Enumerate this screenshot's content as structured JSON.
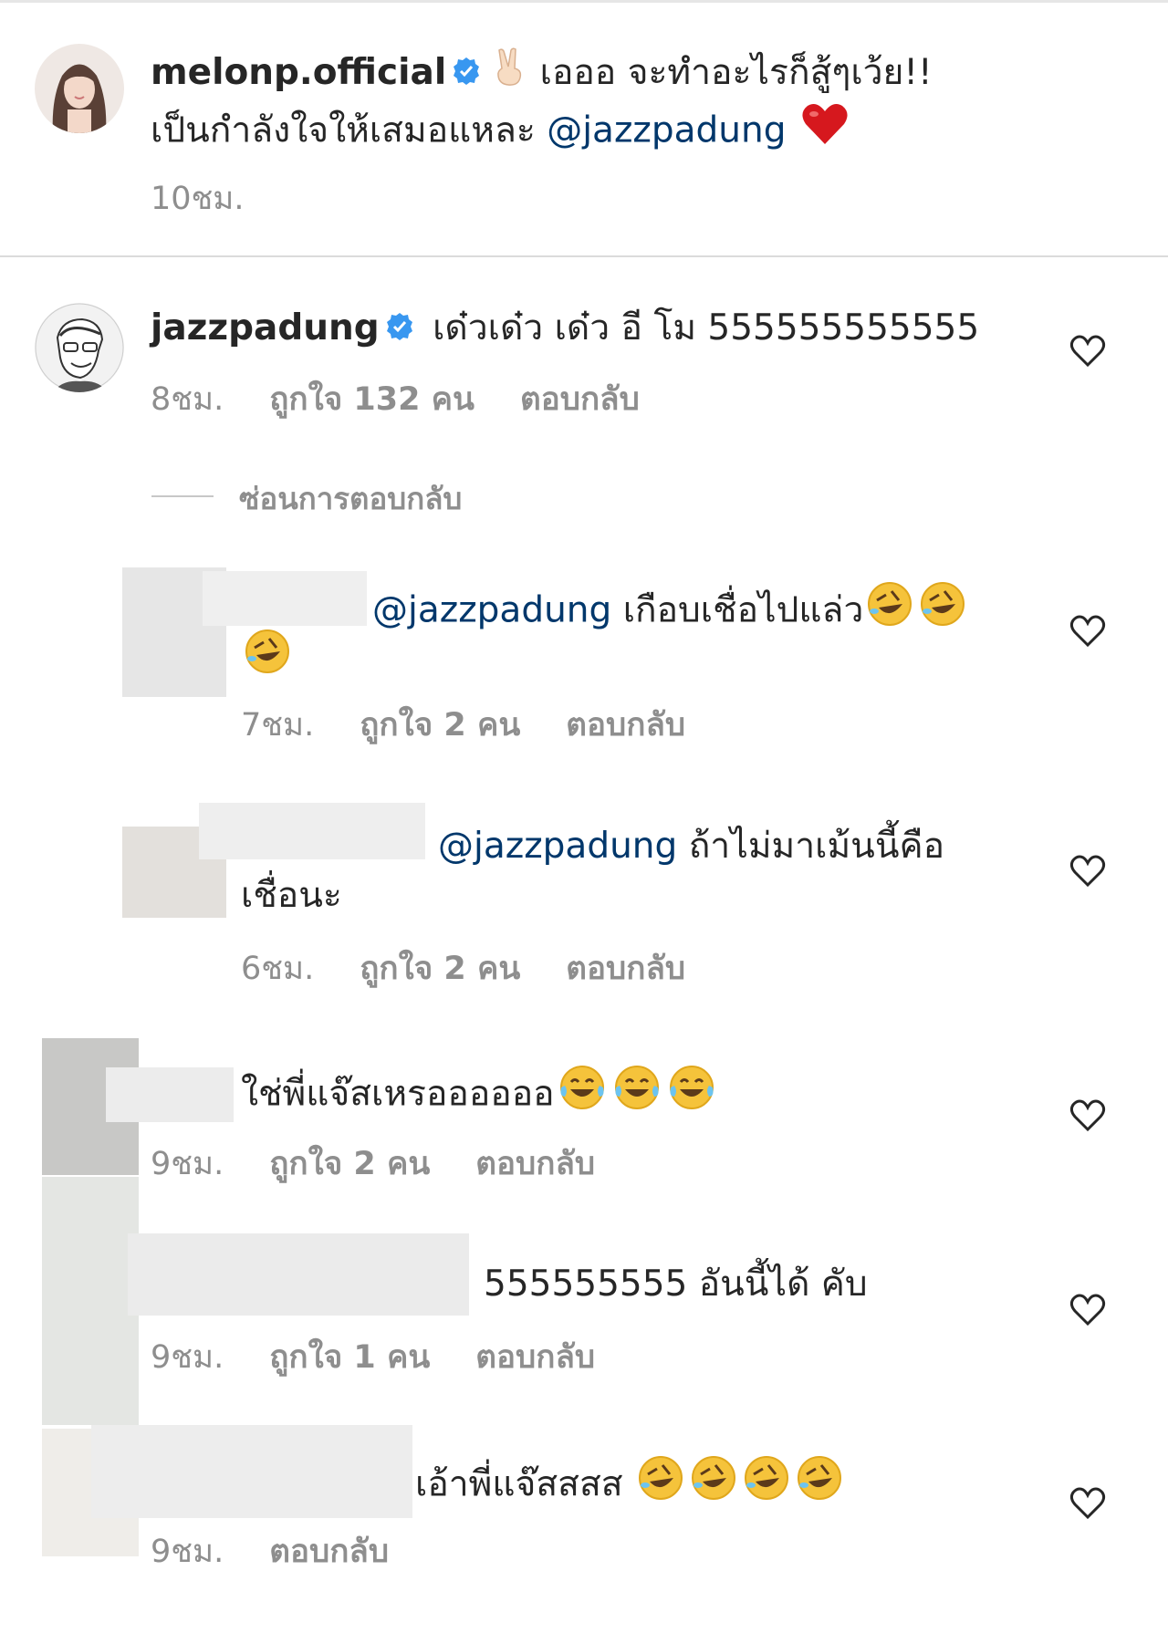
{
  "caption": {
    "username": "melonp.official",
    "text_part1": "เอออ จะทำอะไรก็สู้ๆเว้ย!!",
    "text_part2": "เป็นกำลังใจให้เสมอแหละ",
    "mention": "@jazzpadung",
    "time": "10ชม."
  },
  "comments": [
    {
      "username": "jazzpadung",
      "text": "เด๋วเด๋ว เด๋ว อี โม 555555555555",
      "time": "8ชม.",
      "likes": "ถูกใจ 132 คน",
      "reply": "ตอบกลับ"
    },
    {
      "mention": "@jazzpadung",
      "text": "เกือบเชื่อไปแล่ว",
      "time": "7ชม.",
      "likes": "ถูกใจ 2 คน",
      "reply": "ตอบกลับ"
    },
    {
      "mention": "@jazzpadung",
      "text": "ถ้าไม่มาเม้นนี้คือ",
      "text_line2": "เชื่อนะ",
      "time": "6ชม.",
      "likes": "ถูกใจ 2 คน",
      "reply": "ตอบกลับ"
    },
    {
      "text": "ใช่พี่แจ๊สเหรออออออ",
      "time": "9ชม.",
      "likes": "ถูกใจ 2 คน",
      "reply": "ตอบกลับ"
    },
    {
      "text": "555555555 อันนี้ได้ คับ",
      "time": "9ชม.",
      "likes": "ถูกใจ 1 คน",
      "reply": "ตอบกลับ"
    },
    {
      "text": "เอ้าพี่แจ๊สสสส",
      "time": "9ชม.",
      "reply": "ตอบกลับ"
    }
  ],
  "hide_replies": "ซ่อนการตอบกลับ",
  "icons": [
    "verified-badge-icon",
    "victory-hand-icon",
    "heart-emoji-icon",
    "rofl-emoji-icon",
    "tears-of-joy-emoji-icon",
    "like-heart-icon"
  ],
  "colors": {
    "mention": "#00376b",
    "verified": "#3897f0",
    "meta": "#8e8e8e"
  }
}
